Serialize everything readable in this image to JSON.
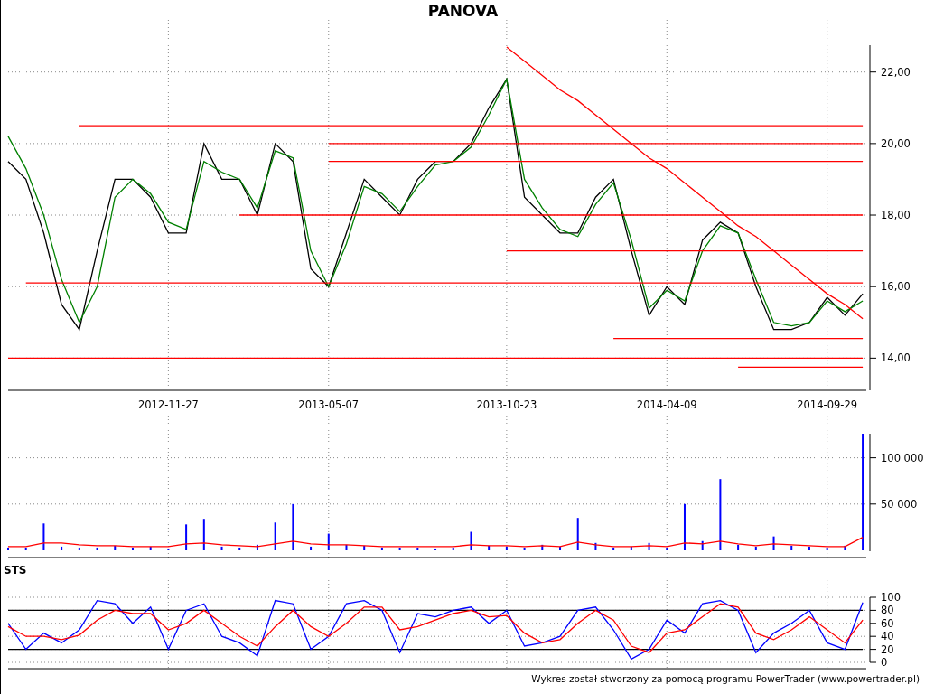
{
  "title": "PANOVA",
  "price_panel": {
    "chart_data": {
      "type": "line",
      "ylim": [
        13.1,
        22.75
      ],
      "grid": true,
      "categories": [
        null,
        null,
        null,
        null,
        null,
        null,
        null,
        null,
        null,
        "2012-11-27",
        null,
        null,
        null,
        null,
        null,
        null,
        null,
        null,
        "2013-05-07",
        null,
        null,
        null,
        null,
        null,
        null,
        null,
        null,
        null,
        "2013-10-23",
        null,
        null,
        null,
        null,
        null,
        null,
        null,
        null,
        "2014-04-09",
        null,
        null,
        null,
        null,
        null,
        null,
        null,
        null,
        "2014-09-29",
        null,
        null
      ],
      "yticks": [
        {
          "value": 14,
          "label": "14,00"
        },
        {
          "value": 16,
          "label": "16,00"
        },
        {
          "value": 18,
          "label": "18,00"
        },
        {
          "value": 20,
          "label": "20,00"
        },
        {
          "value": 22,
          "label": "22,00"
        }
      ],
      "series": [
        {
          "color": "#000000",
          "values": [
            19.5,
            19,
            17.5,
            15.5,
            14.8,
            17,
            19,
            19,
            18.5,
            17.5,
            17.5,
            20,
            19,
            19,
            18,
            20,
            19.5,
            16.5,
            16,
            17.5,
            19,
            18.5,
            18,
            19,
            19.5,
            19.5,
            20,
            21,
            21.8,
            18.5,
            18,
            17.5,
            17.5,
            18.5,
            19,
            17,
            15.2,
            16,
            15.5,
            17.3,
            17.8,
            17.5,
            16,
            14.8,
            14.8,
            15,
            15.7,
            15.2,
            15.8
          ]
        },
        {
          "color": "#008000",
          "values": [
            20.2,
            19.3,
            18,
            16.2,
            15,
            16,
            18.5,
            19,
            18.6,
            17.8,
            17.6,
            19.5,
            19.2,
            19,
            18.2,
            19.8,
            19.6,
            17,
            16,
            17.2,
            18.8,
            18.6,
            18.1,
            18.8,
            19.4,
            19.5,
            19.9,
            20.8,
            21.8,
            19,
            18.2,
            17.6,
            17.4,
            18.3,
            18.9,
            17.3,
            15.4,
            15.9,
            15.6,
            17,
            17.7,
            17.5,
            16.2,
            15,
            14.9,
            15,
            15.6,
            15.3,
            15.6
          ]
        },
        {
          "color": "#ff0000",
          "values": [
            null,
            null,
            null,
            null,
            20.5,
            20.5,
            20.5,
            20.5,
            20.5,
            20.5,
            20.5,
            20.5,
            20.5,
            20.5,
            20.5,
            20.5,
            20.5,
            20.5,
            20.5,
            20.5,
            20.5,
            20.5,
            20.5,
            20.5,
            20.5,
            20.5,
            20.5,
            20.5,
            20.5,
            20.5,
            20.5,
            20.5,
            20.5,
            20.5,
            20.5,
            20.5,
            20.5,
            20.5,
            20.5,
            20.5,
            20.5,
            20.5,
            20.5,
            20.5,
            20.5,
            20.5,
            20.5,
            20.5,
            20.5
          ]
        },
        {
          "color": "#ff0000",
          "values": [
            null,
            null,
            null,
            null,
            null,
            null,
            null,
            null,
            null,
            null,
            null,
            null,
            null,
            null,
            null,
            null,
            null,
            null,
            20,
            20,
            20,
            20,
            20,
            20,
            20,
            20,
            20,
            20,
            20,
            20,
            20,
            20,
            20,
            20,
            20,
            20,
            20,
            20,
            20,
            20,
            20,
            20,
            20,
            20,
            20,
            20,
            20,
            20,
            20
          ]
        },
        {
          "color": "#ff0000",
          "values": [
            null,
            null,
            null,
            null,
            null,
            null,
            null,
            null,
            null,
            null,
            null,
            null,
            null,
            null,
            null,
            null,
            null,
            null,
            19.5,
            19.5,
            19.5,
            19.5,
            19.5,
            19.5,
            19.5,
            19.5,
            19.5,
            19.5,
            19.5,
            19.5,
            19.5,
            19.5,
            19.5,
            19.5,
            19.5,
            19.5,
            19.5,
            19.5,
            19.5,
            19.5,
            19.5,
            19.5,
            19.5,
            19.5,
            19.5,
            19.5,
            19.5,
            19.5,
            19.5
          ]
        },
        {
          "color": "#ff0000",
          "values": [
            null,
            null,
            null,
            null,
            null,
            null,
            null,
            null,
            null,
            null,
            null,
            null,
            null,
            18,
            18,
            18,
            18,
            18,
            18,
            18,
            18,
            18,
            18,
            18,
            18,
            18,
            18,
            18,
            18,
            18,
            18,
            18,
            18,
            18,
            18,
            18,
            18,
            18,
            18,
            18,
            18,
            18,
            18,
            18,
            18,
            18,
            18,
            18,
            18
          ]
        },
        {
          "color": "#ff0000",
          "values": [
            null,
            null,
            null,
            null,
            null,
            null,
            null,
            null,
            null,
            null,
            null,
            null,
            null,
            null,
            null,
            null,
            null,
            null,
            null,
            null,
            null,
            null,
            null,
            null,
            null,
            null,
            null,
            null,
            17,
            17,
            17,
            17,
            17,
            17,
            17,
            17,
            17,
            17,
            17,
            17,
            17,
            17,
            17,
            17,
            17,
            17,
            17,
            17,
            17
          ]
        },
        {
          "color": "#ff0000",
          "values": [
            null,
            16.1,
            16.1,
            16.1,
            16.1,
            16.1,
            16.1,
            16.1,
            16.1,
            16.1,
            16.1,
            16.1,
            16.1,
            16.1,
            16.1,
            16.1,
            16.1,
            16.1,
            16.1,
            16.1,
            16.1,
            16.1,
            16.1,
            16.1,
            16.1,
            16.1,
            16.1,
            16.1,
            16.1,
            16.1,
            16.1,
            16.1,
            16.1,
            16.1,
            16.1,
            16.1,
            16.1,
            16.1,
            16.1,
            16.1,
            16.1,
            16.1,
            16.1,
            16.1,
            16.1,
            16.1,
            16.1,
            16.1,
            16.1
          ]
        },
        {
          "color": "#ff0000",
          "values": [
            null,
            null,
            null,
            null,
            null,
            null,
            null,
            null,
            null,
            null,
            null,
            null,
            null,
            null,
            null,
            null,
            null,
            null,
            null,
            null,
            null,
            null,
            null,
            null,
            null,
            null,
            null,
            null,
            null,
            null,
            null,
            null,
            null,
            null,
            14.55,
            14.55,
            14.55,
            14.55,
            14.55,
            14.55,
            14.55,
            14.55,
            14.55,
            14.55,
            14.55,
            14.55,
            14.55,
            14.55,
            14.55
          ]
        },
        {
          "color": "#ff0000",
          "values": [
            14,
            14,
            14,
            14,
            14,
            14,
            14,
            14,
            14,
            14,
            14,
            14,
            14,
            14,
            14,
            14,
            14,
            14,
            14,
            14,
            14,
            14,
            14,
            14,
            14,
            14,
            14,
            14,
            14,
            14,
            14,
            14,
            14,
            14,
            14,
            14,
            14,
            14,
            14,
            14,
            14,
            14,
            14,
            14,
            14,
            14,
            14,
            14,
            14
          ]
        },
        {
          "color": "#ff0000",
          "values": [
            null,
            null,
            null,
            null,
            null,
            null,
            null,
            null,
            null,
            null,
            null,
            null,
            null,
            null,
            null,
            null,
            null,
            null,
            null,
            null,
            null,
            null,
            null,
            null,
            null,
            null,
            null,
            null,
            null,
            null,
            null,
            null,
            null,
            null,
            null,
            null,
            null,
            null,
            null,
            null,
            null,
            13.75,
            13.75,
            13.75,
            13.75,
            13.75,
            13.75,
            13.75,
            13.75
          ]
        },
        {
          "color": "#ff0000",
          "values": [
            null,
            null,
            null,
            null,
            null,
            null,
            null,
            null,
            null,
            null,
            null,
            null,
            null,
            null,
            null,
            null,
            null,
            null,
            null,
            null,
            null,
            null,
            null,
            null,
            null,
            null,
            null,
            null,
            22.7,
            22.3,
            21.9,
            21.5,
            21.2,
            20.8,
            20.4,
            20,
            19.6,
            19.3,
            18.9,
            18.5,
            18.1,
            17.7,
            17.4,
            17,
            16.6,
            16.2,
            15.8,
            15.5,
            15.1
          ]
        }
      ]
    }
  },
  "volume_panel": {
    "chart_data": {
      "type": "bar",
      "ylim": [
        0,
        126000
      ],
      "grid": true,
      "categories": [
        null,
        null,
        null,
        null,
        null,
        null,
        null,
        null,
        null,
        null,
        null,
        null,
        null,
        null,
        null,
        null,
        null,
        null,
        null,
        null,
        null,
        null,
        null,
        null,
        null,
        null,
        null,
        null,
        null,
        null,
        null,
        null,
        null,
        null,
        null,
        null,
        null,
        null,
        null,
        null,
        null,
        null,
        null,
        null,
        null,
        null,
        null,
        null,
        null
      ],
      "yticks": [
        {
          "value": 50000,
          "label": "50 000"
        },
        {
          "value": 100000,
          "label": "100 000"
        }
      ],
      "series": [
        {
          "color": "#0000ff",
          "values": [
            3000,
            3000,
            29000,
            4000,
            3000,
            3000,
            5000,
            3000,
            4000,
            2000,
            28000,
            34000,
            4000,
            3000,
            6000,
            30000,
            50000,
            4000,
            18000,
            6000,
            5000,
            3000,
            3000,
            3000,
            2000,
            3000,
            20000,
            5000,
            4000,
            3000,
            6000,
            4000,
            35000,
            8000,
            3000,
            4000,
            8000,
            3000,
            50000,
            10000,
            77000,
            6000,
            4000,
            15000,
            5000,
            4000,
            3000,
            5000,
            126000
          ]
        },
        {
          "type": "line",
          "color": "#ff0000",
          "values": [
            4000,
            4000,
            8000,
            8000,
            6000,
            5000,
            5000,
            4000,
            4000,
            4000,
            7000,
            8000,
            6000,
            5000,
            4000,
            7000,
            10000,
            7000,
            6000,
            6000,
            5000,
            4000,
            4000,
            4000,
            4000,
            4000,
            6000,
            5000,
            5000,
            4000,
            5000,
            4000,
            9000,
            6000,
            4000,
            4000,
            5000,
            4000,
            8000,
            7000,
            10000,
            7000,
            5000,
            7000,
            6000,
            5000,
            4000,
            4000,
            14000
          ]
        }
      ]
    }
  },
  "sts_panel": {
    "label": "STS",
    "chart_data": {
      "type": "line",
      "ylim": [
        0,
        100
      ],
      "grid": true,
      "categories": [
        null,
        null,
        null,
        null,
        null,
        null,
        null,
        null,
        null,
        null,
        null,
        null,
        null,
        null,
        null,
        null,
        null,
        null,
        null,
        null,
        null,
        null,
        null,
        null,
        null,
        null,
        null,
        null,
        null,
        null,
        null,
        null,
        null,
        null,
        null,
        null,
        null,
        null,
        null,
        null,
        null,
        null,
        null,
        null,
        null,
        null,
        null,
        null,
        null
      ],
      "yticks": [
        {
          "value": 0,
          "label": "0"
        },
        {
          "value": 20,
          "label": "20"
        },
        {
          "value": 40,
          "label": "40"
        },
        {
          "value": 60,
          "label": "60"
        },
        {
          "value": 80,
          "label": "80"
        },
        {
          "value": 100,
          "label": "100"
        }
      ],
      "series": [
        {
          "color": "#000000",
          "values": [
            20,
            20,
            20,
            20,
            20,
            20,
            20,
            20,
            20,
            20,
            20,
            20,
            20,
            20,
            20,
            20,
            20,
            20,
            20,
            20,
            20,
            20,
            20,
            20,
            20,
            20,
            20,
            20,
            20,
            20,
            20,
            20,
            20,
            20,
            20,
            20,
            20,
            20,
            20,
            20,
            20,
            20,
            20,
            20,
            20,
            20,
            20,
            20,
            20
          ]
        },
        {
          "color": "#000000",
          "values": [
            80,
            80,
            80,
            80,
            80,
            80,
            80,
            80,
            80,
            80,
            80,
            80,
            80,
            80,
            80,
            80,
            80,
            80,
            80,
            80,
            80,
            80,
            80,
            80,
            80,
            80,
            80,
            80,
            80,
            80,
            80,
            80,
            80,
            80,
            80,
            80,
            80,
            80,
            80,
            80,
            80,
            80,
            80,
            80,
            80,
            80,
            80,
            80,
            80
          ]
        },
        {
          "color": "#0000ff",
          "values": [
            60,
            20,
            45,
            30,
            50,
            95,
            90,
            60,
            85,
            20,
            80,
            90,
            40,
            30,
            10,
            95,
            90,
            20,
            40,
            90,
            95,
            80,
            15,
            75,
            70,
            80,
            85,
            60,
            80,
            25,
            30,
            40,
            80,
            85,
            50,
            5,
            20,
            65,
            45,
            90,
            95,
            80,
            15,
            45,
            60,
            80,
            30,
            20,
            92
          ]
        },
        {
          "color": "#ff0000",
          "values": [
            55,
            40,
            40,
            35,
            42,
            65,
            80,
            75,
            75,
            50,
            60,
            80,
            60,
            40,
            25,
            55,
            80,
            55,
            40,
            60,
            85,
            85,
            50,
            55,
            65,
            75,
            80,
            70,
            72,
            45,
            30,
            35,
            60,
            80,
            65,
            25,
            15,
            45,
            50,
            70,
            90,
            85,
            45,
            35,
            50,
            70,
            50,
            30,
            65
          ]
        }
      ]
    }
  },
  "footer": "Wykres został stworzony za pomocą programu PowerTrader (www.powertrader.pl)"
}
